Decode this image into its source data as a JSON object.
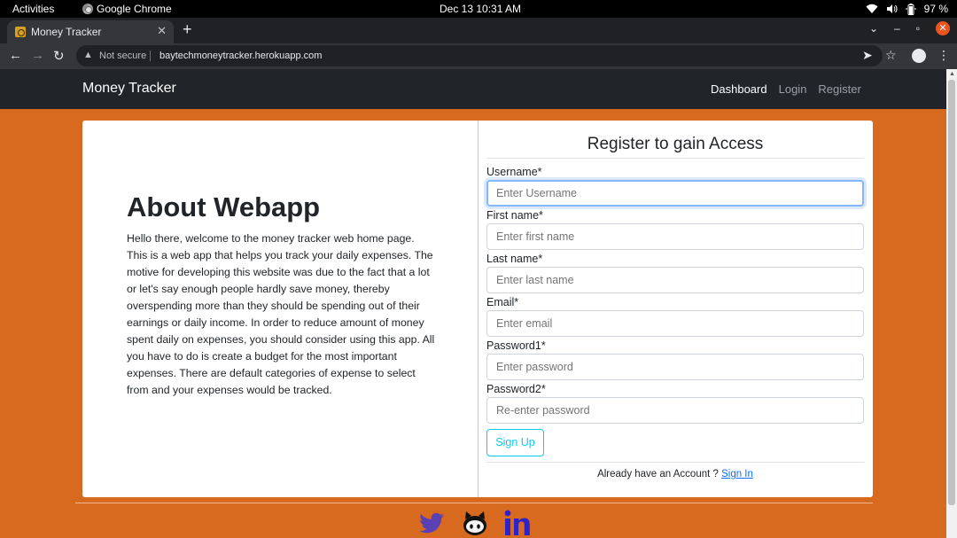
{
  "os": {
    "activities": "Activities",
    "app_name": "Google Chrome",
    "clock": "Dec 13  10:31 AM",
    "battery": "97 %"
  },
  "browser": {
    "tab_title": "Money Tracker",
    "security": "Not secure",
    "url": "baytechmoneytracker.herokuapp.com"
  },
  "navbar": {
    "brand": "Money Tracker",
    "links": [
      "Dashboard",
      "Login",
      "Register"
    ]
  },
  "about": {
    "title": "About Webapp",
    "text": "Hello there, welcome to the money tracker web home page. This is a web app that helps you track your daily expenses. The motive for developing this website was due to the fact that a lot or let's say enough people hardly save money, thereby overspending more than they should be spending out of their earnings or daily income. In order to reduce amount of money spent daily on expenses, you should consider using this app. All you have to do is create a budget for the most important expenses. There are default categories of expense to select from and your expenses would be tracked."
  },
  "register": {
    "title": "Register to gain Access",
    "fields": [
      {
        "label": "Username*",
        "placeholder": "Enter Username"
      },
      {
        "label": "First name*",
        "placeholder": "Enter first name"
      },
      {
        "label": "Last name*",
        "placeholder": "Enter last name"
      },
      {
        "label": "Email*",
        "placeholder": "Enter email"
      },
      {
        "label": "Password1*",
        "placeholder": "Enter password"
      },
      {
        "label": "Password2*",
        "placeholder": "Re-enter password"
      }
    ],
    "submit_label": "Sign Up",
    "signin_prompt": "Already have an Account ? ",
    "signin_link": "Sign In"
  },
  "footer": {
    "social_icons": [
      "twitter-icon",
      "github-icon",
      "linkedin-icon"
    ],
    "twitter_color": "#5b3fb5",
    "github_color": "#111111",
    "linkedin_color": "#2f22c9"
  },
  "colors": {
    "page_background": "#d86a1f",
    "navbar": "#212529",
    "button_outline": "#0dcaf0"
  }
}
